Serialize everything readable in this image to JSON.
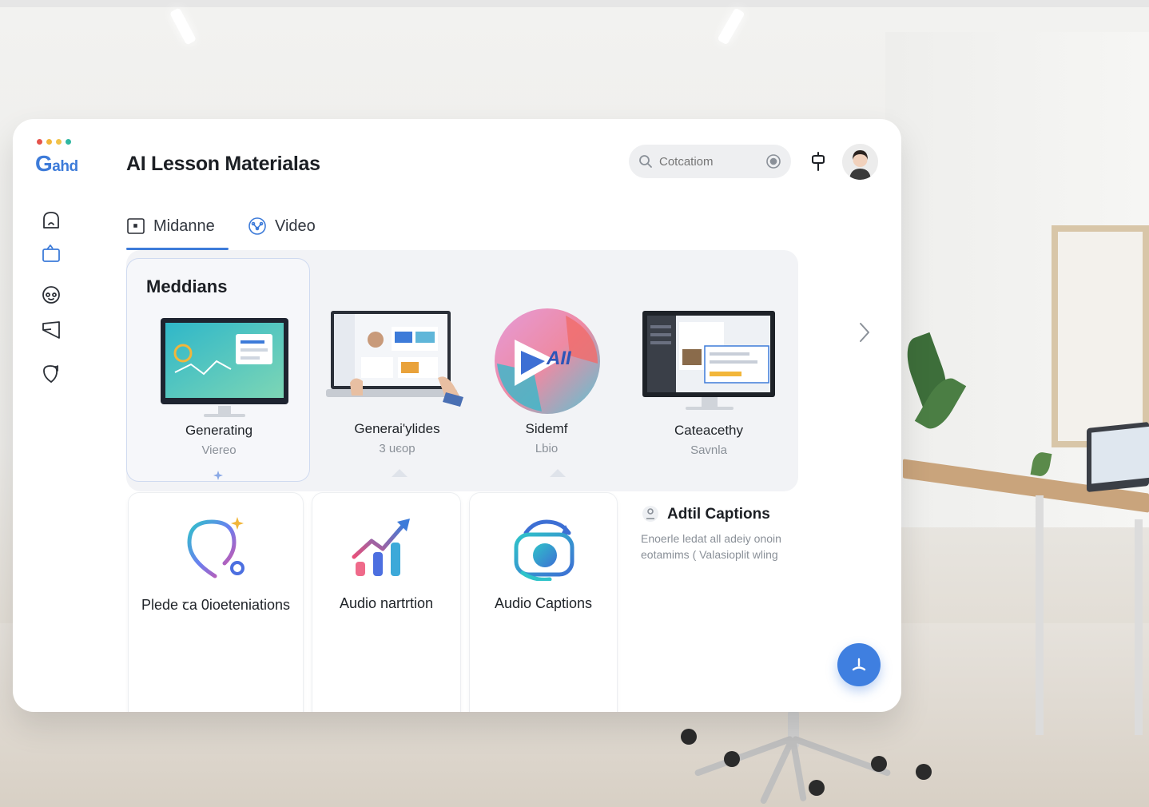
{
  "app": {
    "logo_text": "ahd",
    "title": "AI Lesson Materialas"
  },
  "search": {
    "placeholder": "Cotcatiom"
  },
  "sidebar": {
    "items": [
      {
        "icon": "home-icon"
      },
      {
        "icon": "folder-icon"
      },
      {
        "icon": "face-icon"
      },
      {
        "icon": "send-icon"
      },
      {
        "icon": "shield-icon"
      }
    ]
  },
  "tabs": [
    {
      "label": "Midanne",
      "icon": "square-icon",
      "active": true
    },
    {
      "label": "Video",
      "icon": "network-icon",
      "active": false
    }
  ],
  "carousel": {
    "title": "Meddians",
    "items": [
      {
        "label": "Generating",
        "sub": "Viereo"
      },
      {
        "label": "Generai'ylides",
        "sub": "3 uєop"
      },
      {
        "label": "Sidemf",
        "sub": "Lbio",
        "badge": "AII"
      },
      {
        "label": "Cateacethy",
        "sub": "Savnla"
      }
    ]
  },
  "cards": [
    {
      "label": "Plede ꞇa 0ioeteniations",
      "icon": "speech-bubble-icon"
    },
    {
      "label": "Audio nartrtion",
      "icon": "trend-chart-icon"
    },
    {
      "label": "Audio Captions",
      "icon": "refresh-camera-icon"
    }
  ],
  "info": {
    "title": "Adtil Captions",
    "desc": "Enoerle ledat all adeiy onoin eotamims ( Valasioplit wling"
  },
  "colors": {
    "accent": "#3d7bd9",
    "fab": "#3f7fe0"
  }
}
